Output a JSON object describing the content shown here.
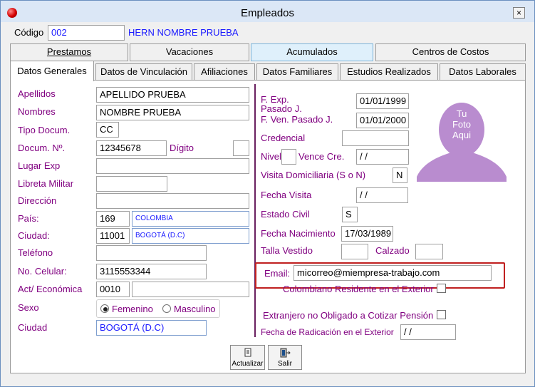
{
  "window": {
    "title": "Empleados",
    "close_label": "×"
  },
  "header": {
    "code_label": "Código",
    "code_value": "002",
    "employee_name": "HERN NOMBRE PRUEBA"
  },
  "tabs_top": [
    "Prestamos",
    "Vacaciones",
    "Acumulados",
    "Centros de Costos"
  ],
  "tabs_bottom": [
    "Datos Generales",
    "Datos de Vinculación",
    "Afiliaciones",
    "Datos Familiares",
    "Estudios Realizados",
    "Datos Laborales"
  ],
  "left": {
    "apellidos_label": "Apellidos",
    "apellidos_value": "APELLIDO PRUEBA",
    "nombres_label": "Nombres",
    "nombres_value": "NOMBRE PRUEBA",
    "tipo_doc_label": "Tipo Docum.",
    "tipo_doc_value": "CC",
    "docum_no_label": "Docum. Nº.",
    "docum_no_value": "12345678",
    "digito_label": "Dígito",
    "digito_value": "",
    "lugar_exp_label": "Lugar Exp",
    "lugar_exp_value": "",
    "libreta_label": "Libreta Militar",
    "libreta_value": "",
    "direccion_label": "Dirección",
    "direccion_value": "",
    "pais_label": "País:",
    "pais_code": "169",
    "pais_name": "COLOMBIA",
    "ciudad_label": "Ciudad:",
    "ciudad_code": "11001",
    "ciudad_name": "BOGOTÁ (D.C)",
    "telefono_label": "Teléfono",
    "telefono_value": "",
    "celular_label": "No. Celular:",
    "celular_value": "3115553344",
    "act_eco_label": "Act/ Económica",
    "act_eco_code": "0010",
    "act_eco_name": "",
    "sexo_label": "Sexo",
    "sexo_options": [
      "Femenino",
      "Masculino"
    ],
    "sexo_selected": "Femenino",
    "ciudad2_label": "Ciudad",
    "ciudad2_value": "BOGOTÁ (D.C)"
  },
  "right": {
    "fexp_label_1": "F. Exp.",
    "fexp_label_2": "Pasado J.",
    "fexp_value": "01/01/1999",
    "fven_label": "F. Ven. Pasado J.",
    "fven_value": "01/01/2000",
    "credencial_label": "Credencial",
    "credencial_value": "",
    "nivel_label": "Nivel",
    "nivel_value": "",
    "vence_label": "Vence Cre.",
    "vence_value": "/ /",
    "visita_label": "Visita Domiciliaria (S o N)",
    "visita_value": "N",
    "fecha_visita_label": "Fecha Visita",
    "fecha_visita_value": "/ /",
    "estado_civil_label": "Estado Civil",
    "estado_civil_value": "S",
    "fecha_nac_label": "Fecha Nacimiento",
    "fecha_nac_value": "17/03/1989",
    "talla_label": "Talla Vestido",
    "talla_value": "",
    "calzado_label": "Calzado",
    "calzado_value": "",
    "email_label": "Email:",
    "email_value": "micorreo@miempresa-trabajo.com",
    "colombiano_label": "Colombiano Residente en el Exterior",
    "extranjero_label": "Extranjero no Obligado a Cotizar Pensión",
    "fecha_rad_label": "Fecha de Radicación en el Exterior",
    "fecha_rad_value": "/ /",
    "photo_text": [
      "Tu",
      "Foto",
      "Aqui"
    ]
  },
  "buttons": {
    "actualizar": "Actualizar",
    "salir": "Salir"
  },
  "colors": {
    "label": "#800080",
    "link_blue": "#1a1aff",
    "photo": "#b98ccf",
    "highlight": "#c02020"
  }
}
